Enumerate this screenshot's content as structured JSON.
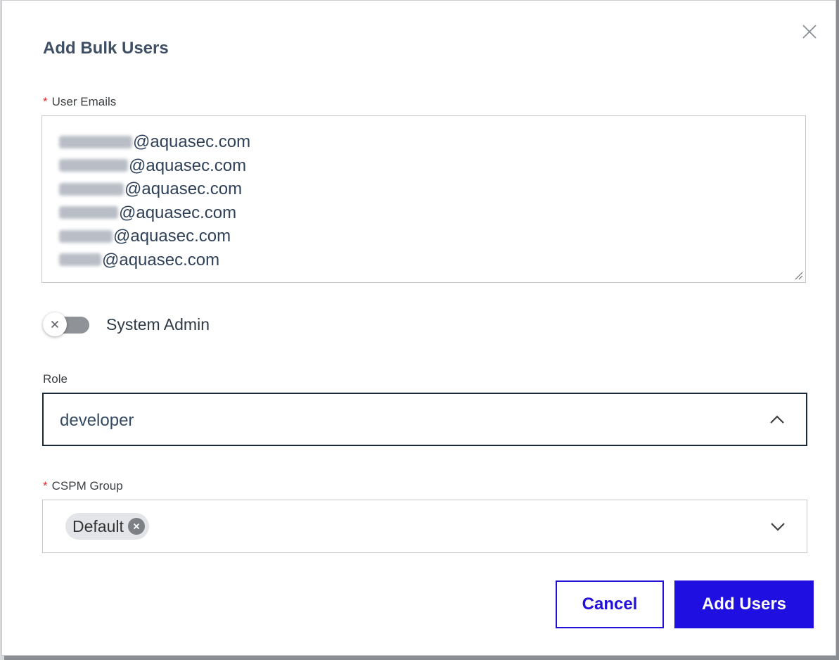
{
  "modal": {
    "title": "Add Bulk Users",
    "close_icon": "close-icon"
  },
  "user_emails": {
    "label": "User Emails",
    "required": "*",
    "lines": [
      {
        "domain": "@aquasec.com"
      },
      {
        "domain": "@aquasec.com"
      },
      {
        "domain": "@aquasec.com"
      },
      {
        "domain": "@aquasec.com"
      },
      {
        "domain": "@aquasec.com"
      },
      {
        "domain": "@aquasec.com"
      }
    ]
  },
  "system_admin": {
    "label": "System Admin",
    "enabled": false,
    "knob_icon": "x-icon"
  },
  "role": {
    "label": "Role",
    "value": "developer",
    "icon": "chevron-up-icon"
  },
  "cspm_group": {
    "label": "CSPM Group",
    "required": "*",
    "tags": [
      {
        "label": "Default"
      }
    ],
    "icon": "chevron-down-icon"
  },
  "actions": {
    "cancel_label": "Cancel",
    "submit_label": "Add Users"
  },
  "colors": {
    "primary": "#1f0fe0",
    "required": "#e5262f",
    "title": "#3e4f64"
  }
}
